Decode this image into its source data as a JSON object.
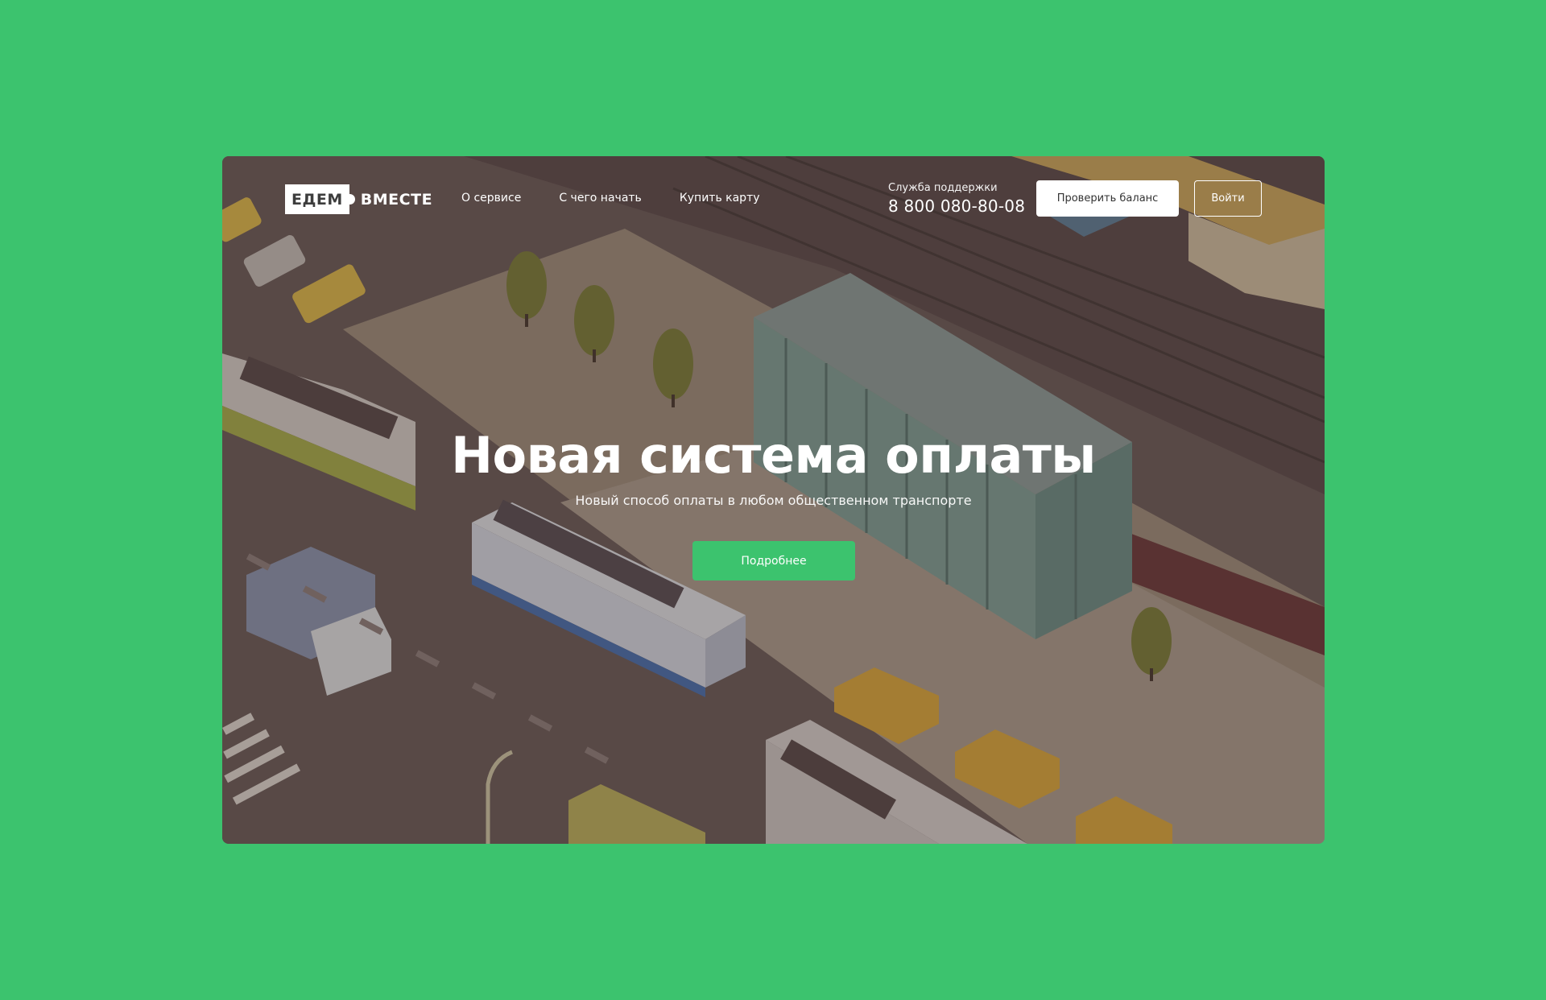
{
  "logo": {
    "box_text": "ЕДЕМ",
    "word": "ВМЕСТЕ"
  },
  "nav": {
    "about": "О сервисе",
    "start": "С чего начать",
    "buy": "Купить карту"
  },
  "support": {
    "label": "Служба поддержки",
    "phone": "8 800 080-80-08"
  },
  "buttons": {
    "check_balance": "Проверить баланс",
    "login": "Войти",
    "more": "Подробнее"
  },
  "hero": {
    "title": "Новая система оплаты",
    "subtitle": "Новый способ оплаты в любом общественном транспорте"
  },
  "colors": {
    "page_background": "#3cc36e",
    "accent": "#3cc36e"
  }
}
